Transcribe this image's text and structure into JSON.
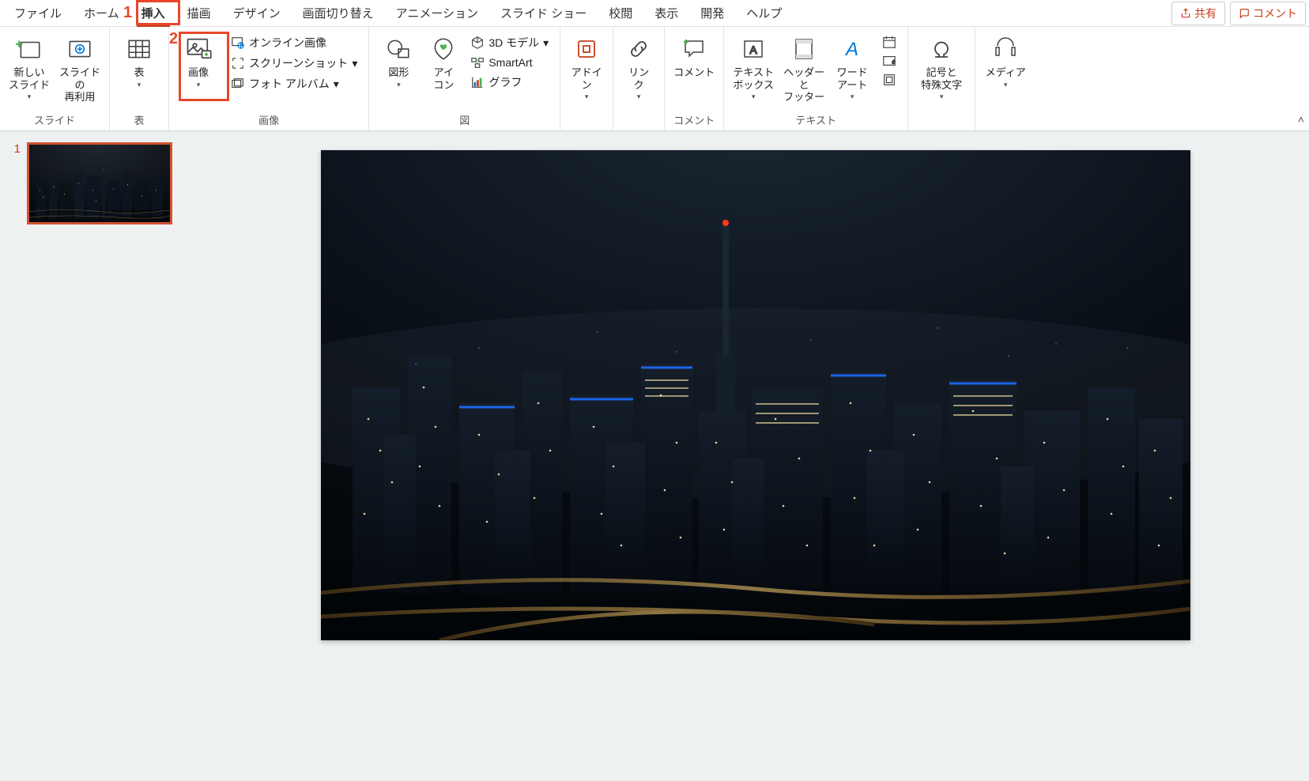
{
  "tabs": {
    "file": "ファイル",
    "home": "ホーム",
    "insert": "挿入",
    "draw": "描画",
    "design": "デザイン",
    "transition": "画面切り替え",
    "animation": "アニメーション",
    "slideshow": "スライド ショー",
    "review": "校閲",
    "view": "表示",
    "developer": "開発",
    "help": "ヘルプ",
    "share": "共有",
    "comment": "コメント"
  },
  "annotations": {
    "hl1": "1",
    "hl2": "2"
  },
  "ribbon": {
    "slides": {
      "group": "スライド",
      "newSlide": "新しい\nスライド",
      "reuse": "スライドの\n再利用"
    },
    "tables": {
      "group": "表",
      "table": "表"
    },
    "images": {
      "group": "画像",
      "image": "画像",
      "online": "オンライン画像",
      "screenshot": "スクリーンショット",
      "album": "フォト アルバム"
    },
    "illustrations": {
      "group": "図",
      "shapes": "図形",
      "icons": "アイ\nコン",
      "3d": "3D モデル",
      "smartart": "SmartArt",
      "chart": "グラフ"
    },
    "addin": {
      "btn": "アドイ\nン"
    },
    "links": {
      "btn": "リン\nク"
    },
    "comments": {
      "group": "コメント",
      "btn": "コメント"
    },
    "text": {
      "group": "テキスト",
      "textbox": "テキスト\nボックス",
      "headerFooter": "ヘッダーと\nフッター",
      "wordart": "ワード\nアート"
    },
    "symbols": {
      "btn": "記号と\n特殊文字"
    },
    "media": {
      "btn": "メディア"
    }
  },
  "thumb": {
    "num": "1"
  }
}
